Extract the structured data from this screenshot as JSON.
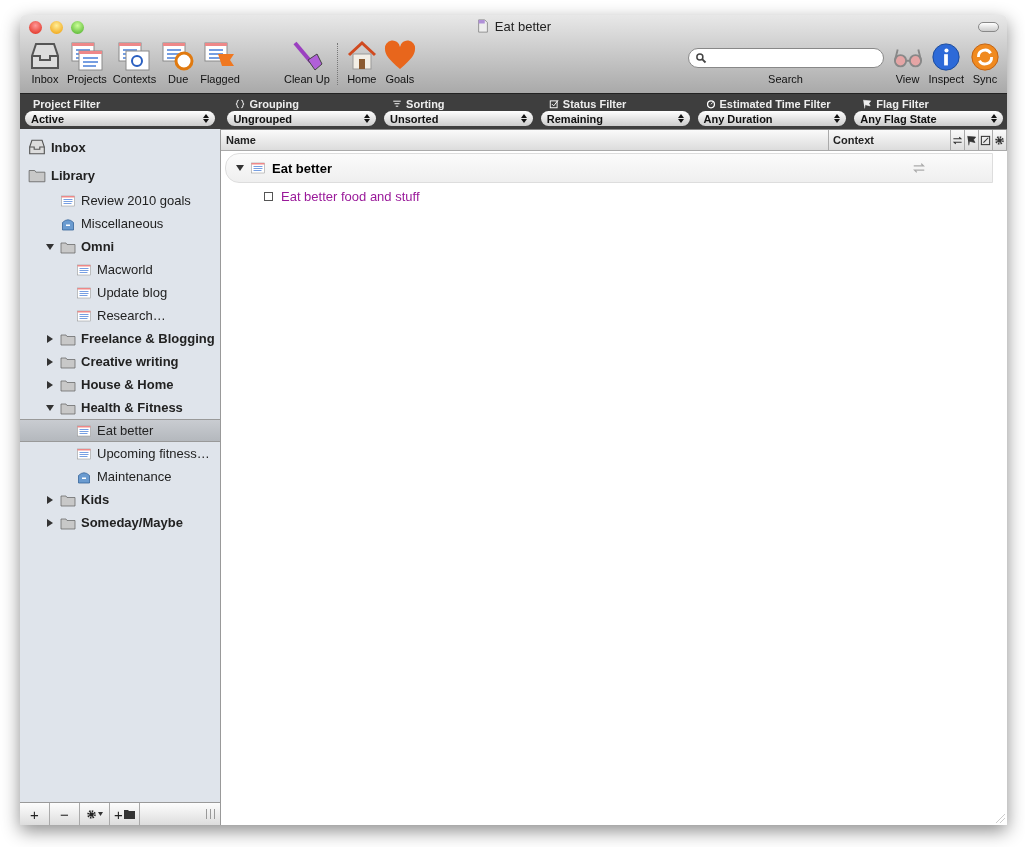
{
  "window": {
    "title": "Eat better"
  },
  "toolbar": {
    "left": [
      {
        "label": "Inbox",
        "kind": "inbox"
      },
      {
        "label": "Projects",
        "kind": "projects"
      },
      {
        "label": "Contexts",
        "kind": "contexts"
      },
      {
        "label": "Due",
        "kind": "due"
      },
      {
        "label": "Flagged",
        "kind": "flagged"
      },
      {
        "label": "Clean Up",
        "kind": "brush"
      },
      {
        "label": "Home",
        "kind": "house"
      },
      {
        "label": "Goals",
        "kind": "heart"
      }
    ],
    "search": {
      "label": "Search"
    },
    "right": [
      {
        "label": "View",
        "kind": "glasses"
      },
      {
        "label": "Inspect",
        "kind": "info"
      },
      {
        "label": "Sync",
        "kind": "sync"
      }
    ]
  },
  "filters": [
    {
      "label": "Project Filter",
      "value": "Active",
      "kind": "none"
    },
    {
      "label": "Grouping",
      "value": "Ungrouped",
      "kind": "braces"
    },
    {
      "label": "Sorting",
      "value": "Unsorted",
      "kind": "sort"
    },
    {
      "label": "Status Filter",
      "value": "Remaining",
      "kind": "check"
    },
    {
      "label": "Estimated Time Filter",
      "value": "Any Duration",
      "kind": "clock"
    },
    {
      "label": "Flag Filter",
      "value": "Any Flag State",
      "kind": "flag"
    }
  ],
  "sidebar": {
    "items": [
      {
        "label": "Inbox",
        "kind": "inbox",
        "selected": false
      },
      {
        "label": "Library",
        "kind": "library",
        "selected": false,
        "children": [
          {
            "label": "Review 2010 goals",
            "kind": "project",
            "selected": false
          },
          {
            "label": "Miscellaneous",
            "kind": "list",
            "selected": false
          },
          {
            "label": "Omni",
            "kind": "folder",
            "expanded": true,
            "selected": false,
            "children": [
              {
                "label": "Macworld",
                "kind": "project",
                "selected": false
              },
              {
                "label": "Update blog",
                "kind": "project",
                "selected": false
              },
              {
                "label": "Research…",
                "kind": "project",
                "selected": false
              }
            ]
          },
          {
            "label": "Freelance & Blogging",
            "kind": "folder",
            "expanded": false,
            "selected": false
          },
          {
            "label": "Creative writing",
            "kind": "folder",
            "expanded": false,
            "selected": false
          },
          {
            "label": "House & Home",
            "kind": "folder",
            "expanded": false,
            "selected": false
          },
          {
            "label": "Health & Fitness",
            "kind": "folder",
            "expanded": true,
            "selected": false,
            "children": [
              {
                "label": "Eat better",
                "kind": "project",
                "selected": true
              },
              {
                "label": "Upcoming fitness…",
                "kind": "project",
                "selected": false
              },
              {
                "label": "Maintenance",
                "kind": "list",
                "selected": false
              }
            ]
          },
          {
            "label": "Kids",
            "kind": "folder",
            "expanded": false,
            "selected": false
          },
          {
            "label": "Someday/Maybe",
            "kind": "folder",
            "expanded": false,
            "selected": false
          }
        ]
      }
    ],
    "buttons": [
      {
        "kind": "add",
        "label": "+"
      },
      {
        "kind": "remove",
        "label": "−"
      },
      {
        "kind": "gear"
      },
      {
        "kind": "folder",
        "label": "+"
      }
    ]
  },
  "outline": {
    "columns": [
      {
        "label": "Name",
        "kind": "text"
      },
      {
        "label": "Context",
        "kind": "text"
      },
      {
        "kind": "repeat"
      },
      {
        "kind": "flag"
      },
      {
        "kind": "note"
      },
      {
        "kind": "gear"
      }
    ],
    "groups": [
      {
        "label": "Eat better",
        "expanded": true,
        "tasks": [
          {
            "label": "Eat better food and stuff",
            "checked": false
          }
        ]
      }
    ]
  }
}
